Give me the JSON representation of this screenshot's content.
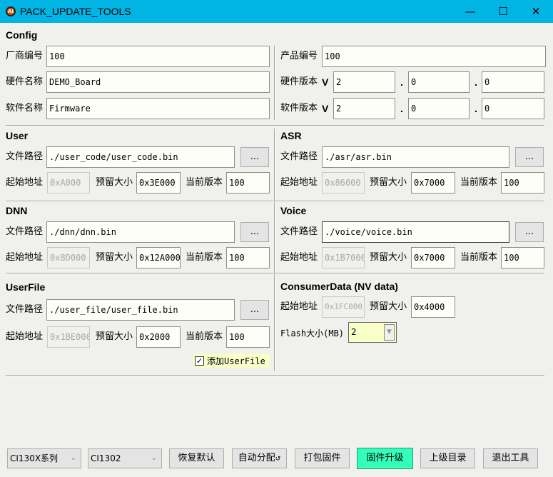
{
  "window": {
    "title": "PACK_UPDATE_TOOLS",
    "logo": "AI",
    "minimize": "—",
    "maximize": "☐",
    "close": "✕"
  },
  "config": {
    "title": "Config",
    "vendor_label": "厂商编号",
    "vendor": "100",
    "hw_name_label": "硬件名称",
    "hw_name": "DEMO_Board",
    "sw_name_label": "软件名称",
    "sw_name": "Firmware",
    "product_label": "产品编号",
    "product": "100",
    "hw_ver_label": "硬件版本",
    "sw_ver_label": "软件版本",
    "v": "V",
    "dot": ".",
    "hw_ver": [
      "2",
      "0",
      "0"
    ],
    "sw_ver": [
      "2",
      "0",
      "0"
    ]
  },
  "labels": {
    "path": "文件路径",
    "addr": "起始地址",
    "size": "预留大小",
    "ver": "当前版本",
    "browse": "..."
  },
  "user": {
    "title": "User",
    "path": "./user_code/user_code.bin",
    "addr": "0xA000",
    "size": "0x3E000",
    "ver": "100"
  },
  "asr": {
    "title": "ASR",
    "path": "./asr/asr.bin",
    "addr": "0x86000",
    "size": "0x7000",
    "ver": "100"
  },
  "dnn": {
    "title": "DNN",
    "path": "./dnn/dnn.bin",
    "addr": "0x8D000",
    "size": "0x12A000",
    "ver": "100"
  },
  "voice": {
    "title": "Voice",
    "path": "./voice/voice.bin",
    "addr": "0x1B7000",
    "size": "0x7000",
    "ver": "100"
  },
  "userfile": {
    "title": "UserFile",
    "path": "./user_file/user_file.bin",
    "addr": "0x1BE000",
    "size": "0x2000",
    "ver": "100",
    "add_label": "添加UserFile",
    "add_checked": true
  },
  "consumer": {
    "title": "ConsumerData (NV data)",
    "addr": "0x1FC000",
    "size": "0x4000",
    "flash_label": "Flash大小(MB)",
    "flash": "2"
  },
  "bottom": {
    "series": "CI130X系列",
    "chip": "CI1302",
    "restore": "恢复默认",
    "auto": "自动分配",
    "pack": "打包固件",
    "upgrade": "固件升级",
    "parent": "上级目录",
    "exit": "退出工具"
  },
  "colors": {
    "titlebar": "#00b4e4",
    "upgrade": "#33ffbb",
    "flash_bg": "#f8ffc8"
  }
}
